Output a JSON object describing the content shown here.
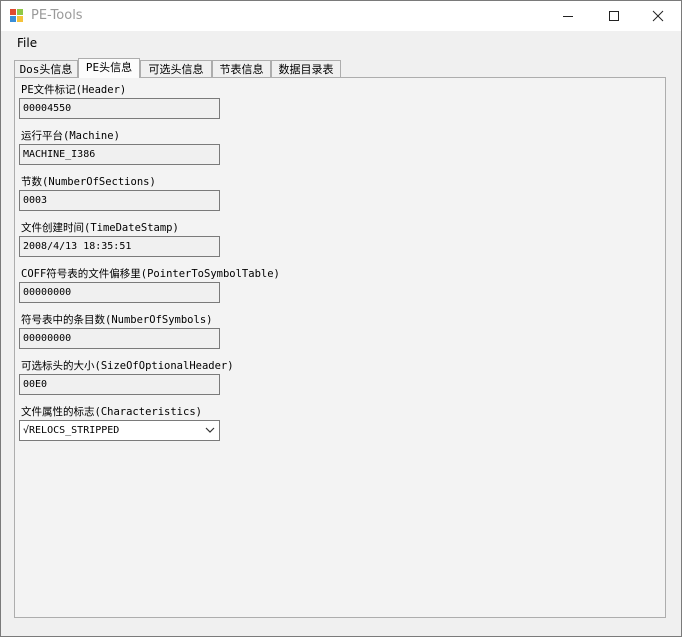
{
  "window": {
    "title": "PE-Tools"
  },
  "menu": {
    "file": "File"
  },
  "tabs": [
    {
      "label": "Dos头信息",
      "active": false
    },
    {
      "label": "PE头信息",
      "active": true
    },
    {
      "label": "可选头信息",
      "active": false
    },
    {
      "label": "节表信息",
      "active": false
    },
    {
      "label": "数据目录表",
      "active": false
    }
  ],
  "fields": [
    {
      "label": "PE文件标记(Header)",
      "value": "00004550"
    },
    {
      "label": "运行平台(Machine)",
      "value": "MACHINE_I386"
    },
    {
      "label": "节数(NumberOfSections)",
      "value": "0003"
    },
    {
      "label": "文件创建时间(TimeDateStamp)",
      "value": "2008/4/13 18:35:51"
    },
    {
      "label": "COFF符号表的文件偏移里(PointerToSymbolTable)",
      "value": "00000000"
    },
    {
      "label": "符号表中的条目数(NumberOfSymbols)",
      "value": "00000000"
    },
    {
      "label": "可选标头的大小(SizeOfOptionalHeader)",
      "value": "00E0"
    },
    {
      "label": "文件属性的标志(Characteristics)",
      "value": "√RELOCS_STRIPPED",
      "type": "dropdown"
    }
  ],
  "icons": {
    "app": "app-windows-icon",
    "minimize": "minimize-icon",
    "maximize": "maximize-icon",
    "close": "close-icon",
    "dropdown": "chevron-down-icon"
  }
}
